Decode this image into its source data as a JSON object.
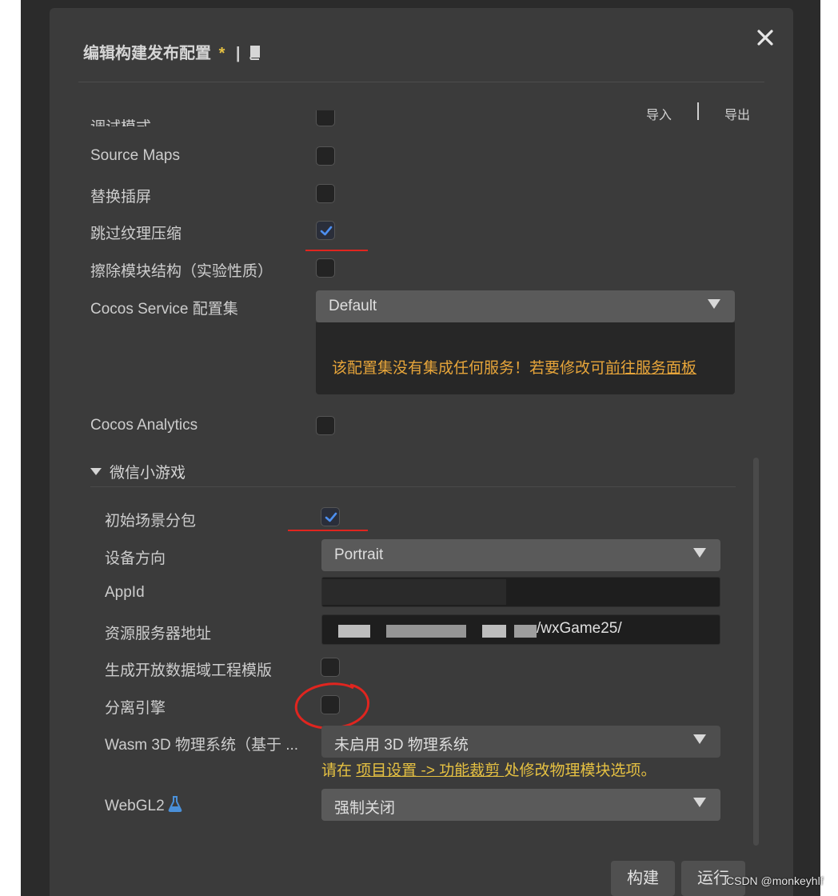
{
  "dialog": {
    "title": "编辑构建发布配置",
    "modified_marker": "*",
    "separator": "|",
    "import_label": "导入",
    "export_label": "导出"
  },
  "rows": {
    "debug_mode_label": "调试模式",
    "source_maps_label": "Source Maps",
    "replace_splash_label": "替换插屏",
    "skip_texture_compress_label": "跳过纹理压缩",
    "erase_module_label": "擦除模块结构（实验性质）",
    "cocos_service_label": "Cocos Service 配置集",
    "cocos_service_value": "Default",
    "service_notice": "该配置集没有集成任何服务！若要修改可",
    "service_link": "前往服务面板",
    "cocos_analytics_label": "Cocos Analytics"
  },
  "states": {
    "debug_mode": false,
    "source_maps": false,
    "replace_splash": false,
    "skip_texture_compress": true,
    "erase_module": false,
    "cocos_analytics": false,
    "initial_scene_subpackage": true,
    "open_data_template": false,
    "separate_engine": false
  },
  "wechat": {
    "section_title": "微信小游戏",
    "initial_scene_label": "初始场景分包",
    "orientation_label": "设备方向",
    "orientation_value": "Portrait",
    "appid_label": "AppId",
    "resource_server_label": "资源服务器地址",
    "resource_server_value_suffix": "/wxGame25/",
    "open_data_label": "生成开放数据域工程模版",
    "separate_engine_label": "分离引擎",
    "wasm_label": "Wasm 3D 物理系统（基于 ...",
    "wasm_value": "未启用 3D 物理系统",
    "note_prefix": "请在 ",
    "note_link": "项目设置 -> 功能裁剪 ",
    "note_suffix": "处修改物理模块选项。",
    "webgl2_label": "WebGL2",
    "webgl2_value": "强制关闭"
  },
  "footer": {
    "build_label": "构建",
    "run_label": "运行"
  },
  "watermark": "CSDN @monkeyhlf",
  "colors": {
    "dialog_bg": "#3b3b3b",
    "notice_orange": "#e7a53a",
    "note_yellow": "#e6c142",
    "flask_blue": "#4a90d9",
    "annotation_red": "#e0251f"
  }
}
